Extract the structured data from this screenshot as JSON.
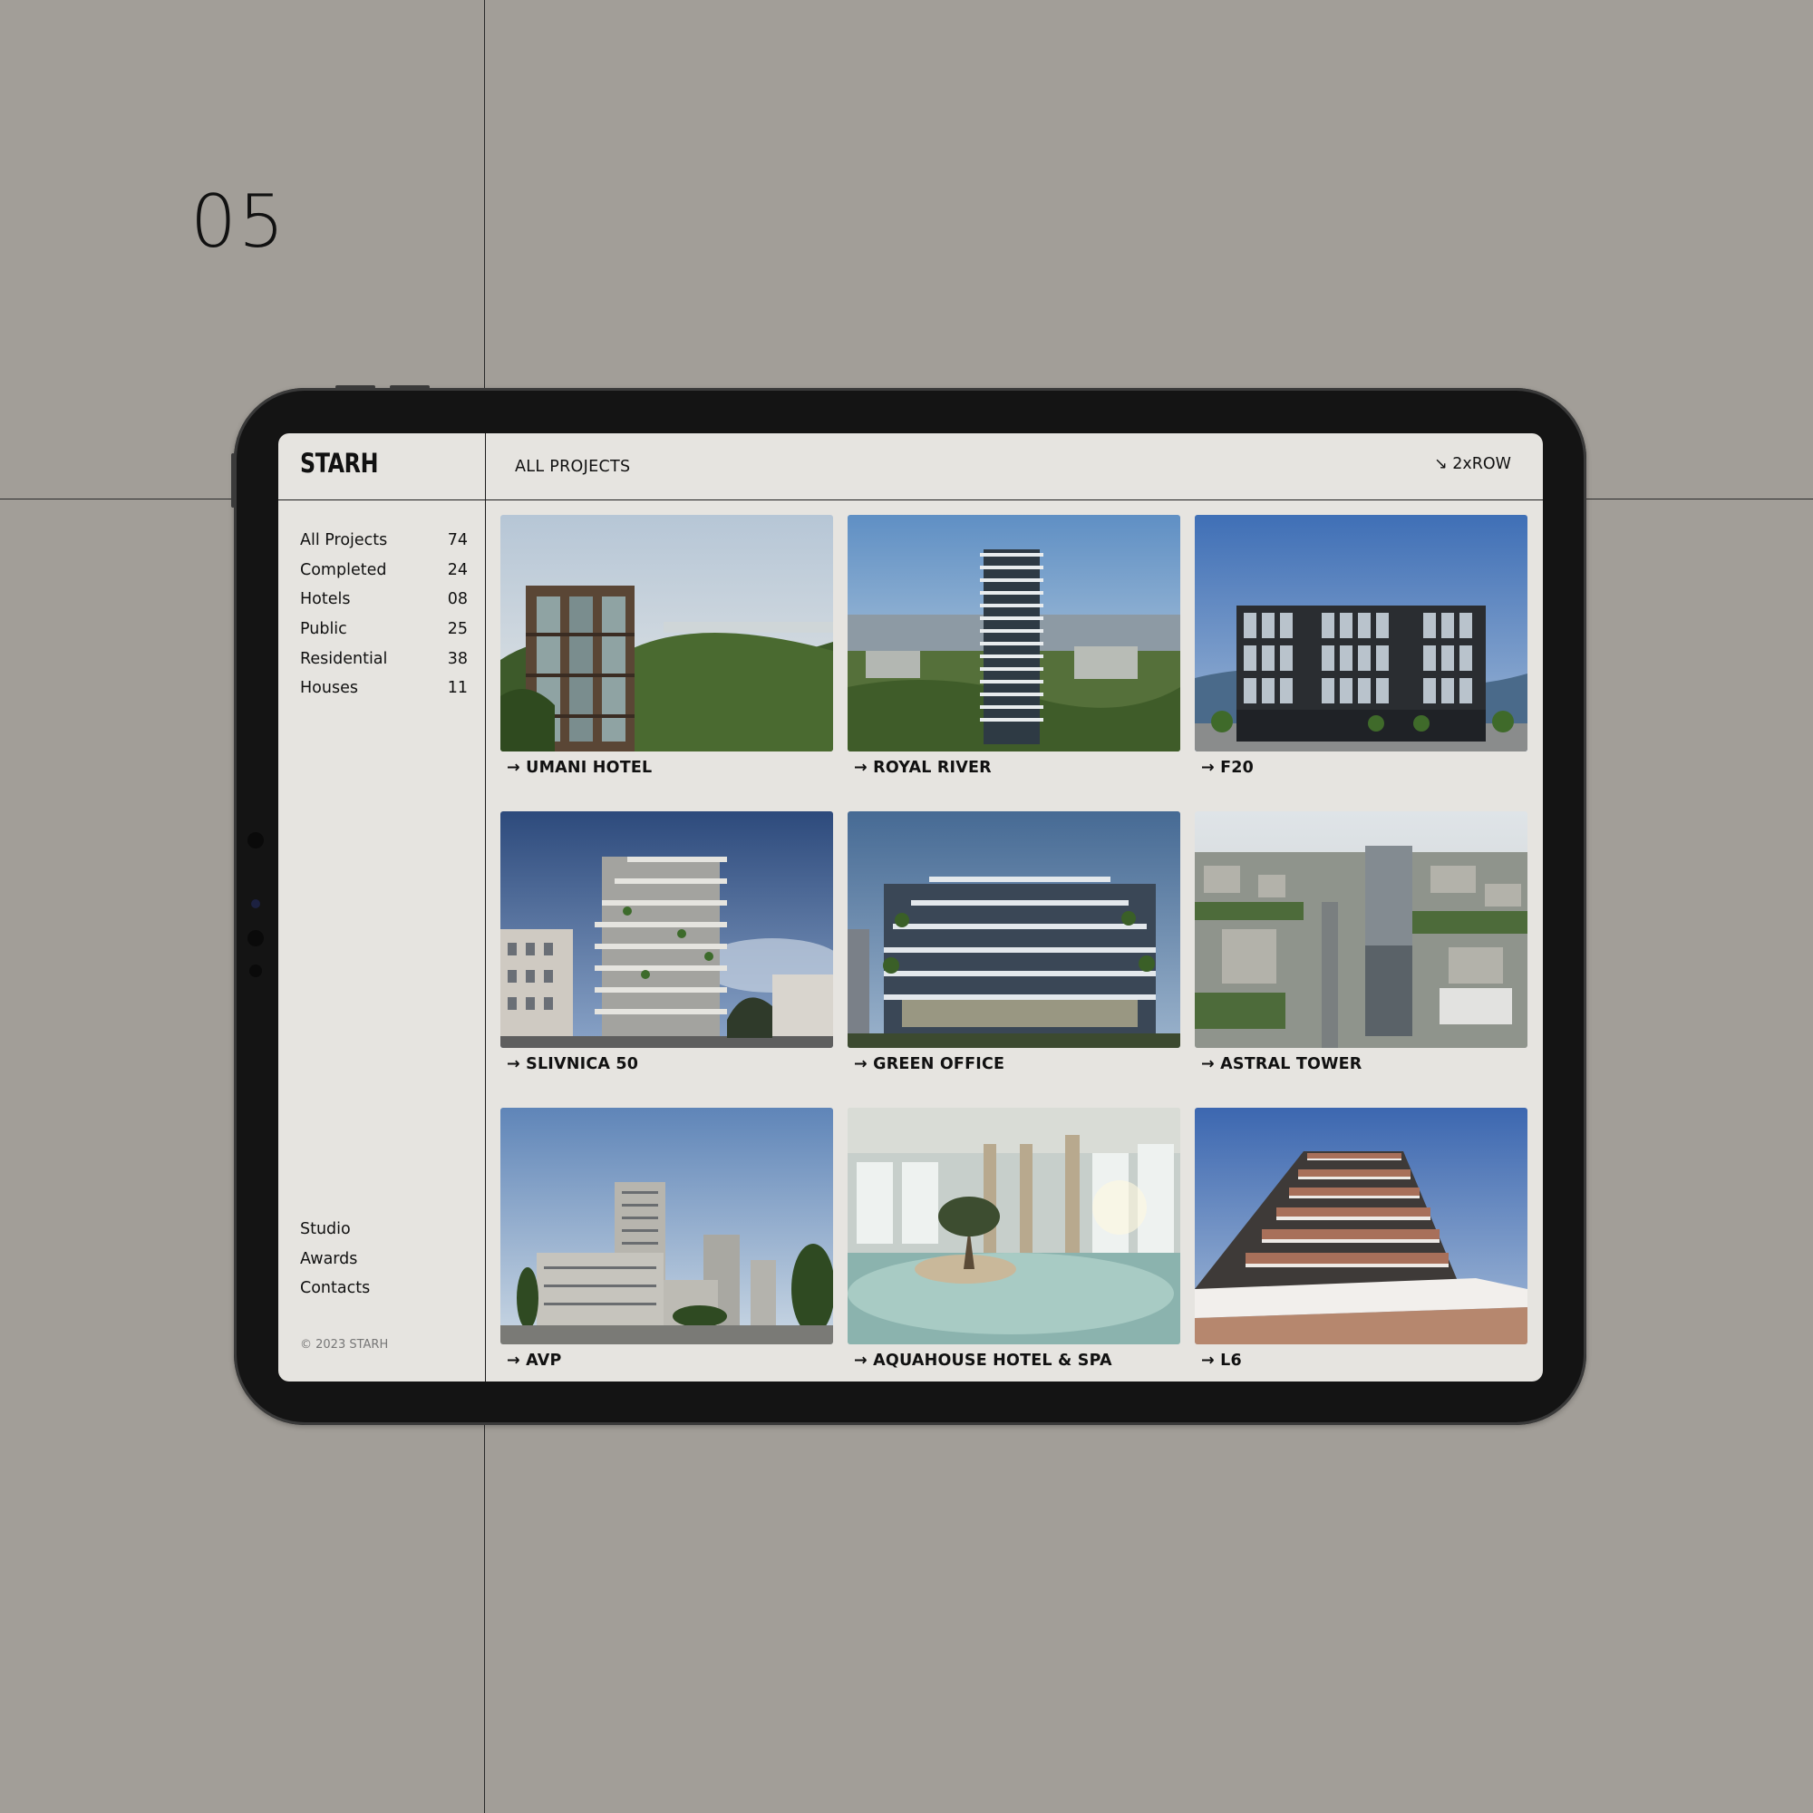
{
  "slide_number": "05",
  "app": {
    "logo": "STARH",
    "page_title": "ALL PROJECTS",
    "layout_toggle": "↘ 2xROW",
    "copyright": "© 2023 STARH"
  },
  "sidebar": {
    "categories": [
      {
        "label": "All Projects",
        "count": "74"
      },
      {
        "label": "Completed",
        "count": "24"
      },
      {
        "label": "Hotels",
        "count": "08"
      },
      {
        "label": "Public",
        "count": "25"
      },
      {
        "label": "Residential",
        "count": "38"
      },
      {
        "label": "Houses",
        "count": "11"
      }
    ],
    "links": [
      {
        "label": "Studio"
      },
      {
        "label": "Awards"
      },
      {
        "label": "Contacts"
      }
    ]
  },
  "projects": [
    {
      "title": "→ UMANI HOTEL"
    },
    {
      "title": "→ ROYAL RIVER"
    },
    {
      "title": "→ F20"
    },
    {
      "title": "→ SLIVNICA 50"
    },
    {
      "title": "→ GREEN OFFICE"
    },
    {
      "title": "→ ASTRAL TOWER"
    },
    {
      "title": "→ AVP"
    },
    {
      "title": "→ AQUAHOUSE HOTEL & SPA"
    },
    {
      "title": "→ L6"
    }
  ]
}
